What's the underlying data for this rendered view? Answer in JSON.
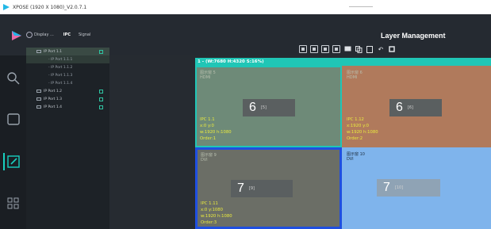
{
  "window": {
    "title": "XPOSE (1920 X 1080)_V2.0.7.1"
  },
  "device_bar": {
    "device": "Display ...",
    "tab_ipc": "IPC",
    "tab_signal": "Signal"
  },
  "panel": {
    "title": "Layer Management"
  },
  "screen": {
    "header": "1 - (W:7680 H:4320 S:16%)"
  },
  "tree": {
    "items": [
      {
        "label": "IP Port 1.1",
        "level": 0,
        "expanded": true,
        "selected": true
      },
      {
        "label": "- IP Port 1.1.1",
        "level": 1,
        "selected": true
      },
      {
        "label": "- IP Port 1.1.2",
        "level": 1
      },
      {
        "label": "- IP Port 1.1.3",
        "level": 1
      },
      {
        "label": "- IP Port 1.1.4",
        "level": 1
      },
      {
        "label": "IP Port 1.2",
        "level": 0
      },
      {
        "label": "IP Port 1.3",
        "level": 0
      },
      {
        "label": "IP Port 1.4",
        "level": 0
      }
    ]
  },
  "windows": [
    {
      "name_line1": "图示窗 5",
      "name_line2": "HDMI",
      "number": "6",
      "number_sub": "[5]",
      "ipc": "IPC  1.1",
      "pos": "x:0  y:0",
      "size": "w:1920  h:1080",
      "order": "Order:1",
      "fill": "#6e8a78",
      "border": "#20c6b6"
    },
    {
      "name_line1": "图示窗 6",
      "name_line2": "HDMI",
      "number": "6",
      "number_sub": "[6]",
      "ipc": "IPC  1.12",
      "pos": "x:1920  y:0",
      "size": "w:1920  h:1080",
      "order": "Order:2",
      "fill": "#b07a5c",
      "border": "#b07a5c"
    },
    {
      "name_line1": "图示窗 9",
      "name_line2": "DVI",
      "number": "7",
      "number_sub": "[9]",
      "ipc": "IPC  1.11",
      "pos": "x:0  y:1080",
      "size": "w:1920  h:1080",
      "order": "Order:3",
      "fill": "#6b6e66",
      "border": "#1f4fe0"
    },
    {
      "name_line1": "图示窗 10",
      "name_line2": "DVI",
      "number": "7",
      "number_sub": "[10]",
      "ipc": "",
      "pos": "",
      "size": "",
      "order": "",
      "fill": "#7fb4ec",
      "border": "#7fb4ec"
    }
  ]
}
